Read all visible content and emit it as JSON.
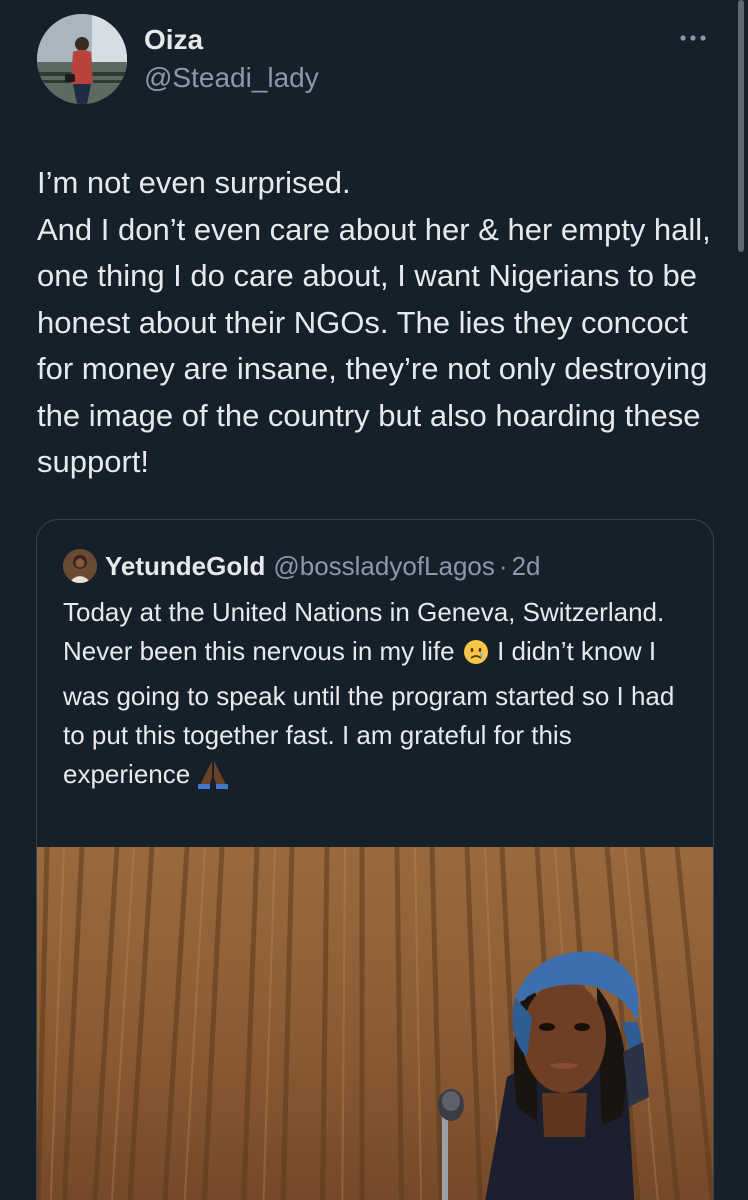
{
  "tweet": {
    "author_name": "Oiza",
    "author_handle": "@Steadi_lady",
    "more_icon": "more-horizontal-icon",
    "text_lines": [
      "I’m not even surprised.",
      "And I don’t even care about her & her empty hall, one thing I do care about, I want Nigerians to be honest about their NGOs. The lies they concoct for money are insane, they’re not only destroying the image of the country but also hoarding these support!"
    ]
  },
  "quoted_tweet": {
    "author_name": "YetundeGold",
    "author_handle": "@bossladyofLagos",
    "separator": "·",
    "time": "2d",
    "text_part1": "Today at the United Nations in Geneva, Switzerland. Never been this nervous in my life",
    "emoji1": "crying-face-emoji",
    "text_part2": "I didn’t know I was going to speak until the program started so I had to put this together fast. I am grateful for this experience",
    "emoji2": "folded-hands-emoji",
    "media": "photo-woman-speaking-at-microphone"
  },
  "colors": {
    "background": "#15202b",
    "primary_text": "#e7e9ea",
    "secondary_text": "#8b98a5",
    "border": "#38444d"
  }
}
